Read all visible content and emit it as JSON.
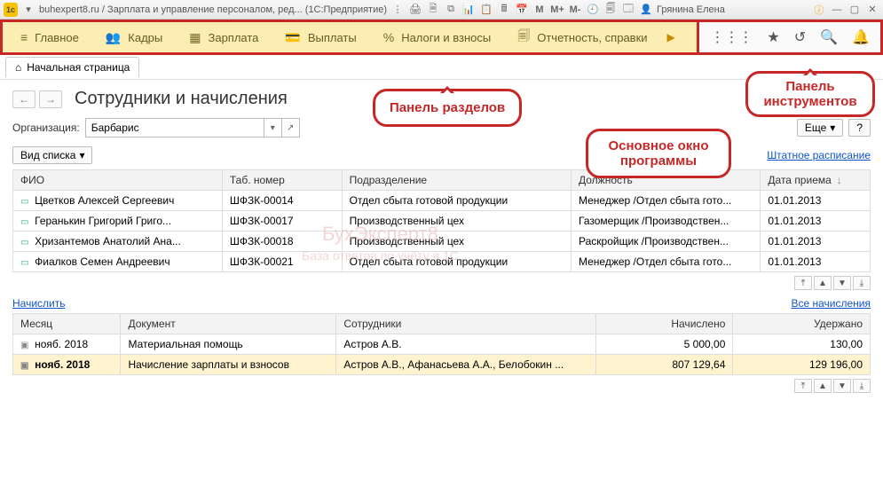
{
  "title": "buhexpert8.ru / Зарплата и управление персоналом, ред... (1С:Предприятие)",
  "user": "Грянина Елена",
  "m_buttons": [
    "M",
    "M+",
    "M-"
  ],
  "panel": {
    "items": [
      {
        "icon": "≡",
        "label": "Главное"
      },
      {
        "icon": "👥",
        "label": "Кадры"
      },
      {
        "icon": "▦",
        "label": "Зарплата"
      },
      {
        "icon": "💳",
        "label": "Выплаты"
      },
      {
        "icon": "%",
        "label": "Налоги и взносы"
      },
      {
        "icon": "🗐",
        "label": "Отчетность, справки"
      }
    ]
  },
  "tabs": {
    "home": "Начальная страница"
  },
  "page_title": "Сотрудники и начисления",
  "org_label": "Организация:",
  "org_value": "Барбарис",
  "more_btn": "Еще",
  "view_btn": "Вид списка",
  "staff_link": "Штатное расписание",
  "calc_link": "Начислить",
  "all_calc_link": "Все начисления",
  "table1": {
    "headers": [
      "ФИО",
      "Таб. номер",
      "Подразделение",
      "Должность",
      "Дата приема"
    ],
    "rows": [
      {
        "fio": "Цветков Алексей Сергеевич",
        "tab": "ШФЗК-00014",
        "dep": "Отдел сбыта готовой продукции",
        "pos": "Менеджер /Отдел сбыта гото...",
        "date": "01.01.2013"
      },
      {
        "fio": "Геранькин Григорий Григо...",
        "tab": "ШФЗК-00017",
        "dep": "Производственный цех",
        "pos": "Газомерщик /Производствен...",
        "date": "01.01.2013"
      },
      {
        "fio": "Хризантемов Анатолий Ана...",
        "tab": "ШФЗК-00018",
        "dep": "Производственный цех",
        "pos": "Раскройщик /Производствен...",
        "date": "01.01.2013"
      },
      {
        "fio": "Фиалков Семен Андреевич",
        "tab": "ШФЗК-00021",
        "dep": "Отдел сбыта готовой продукции",
        "pos": "Менеджер /Отдел сбыта гото...",
        "date": "01.01.2013"
      }
    ]
  },
  "table2": {
    "headers": [
      "Месяц",
      "Документ",
      "Сотрудники",
      "Начислено",
      "Удержано"
    ],
    "rows": [
      {
        "hl": false,
        "month": "нояб. 2018",
        "doc": "Материальная помощь",
        "emp": "Астров А.В.",
        "acc": "5 000,00",
        "ded": "130,00"
      },
      {
        "hl": true,
        "month": "нояб. 2018",
        "doc": "Начисление зарплаты и взносов",
        "emp": "Астров А.В., Афанасьева А.А., Белобокин ...",
        "acc": "807 129,64",
        "ded": "129 196,00"
      }
    ]
  },
  "callouts": {
    "sections": "Панель разделов",
    "tools": "Панель инструментов",
    "main": "Основное окно программы"
  },
  "watermark": {
    "l1": "БухЭксперт8",
    "l2": "База ответов по учёту в 1С"
  }
}
